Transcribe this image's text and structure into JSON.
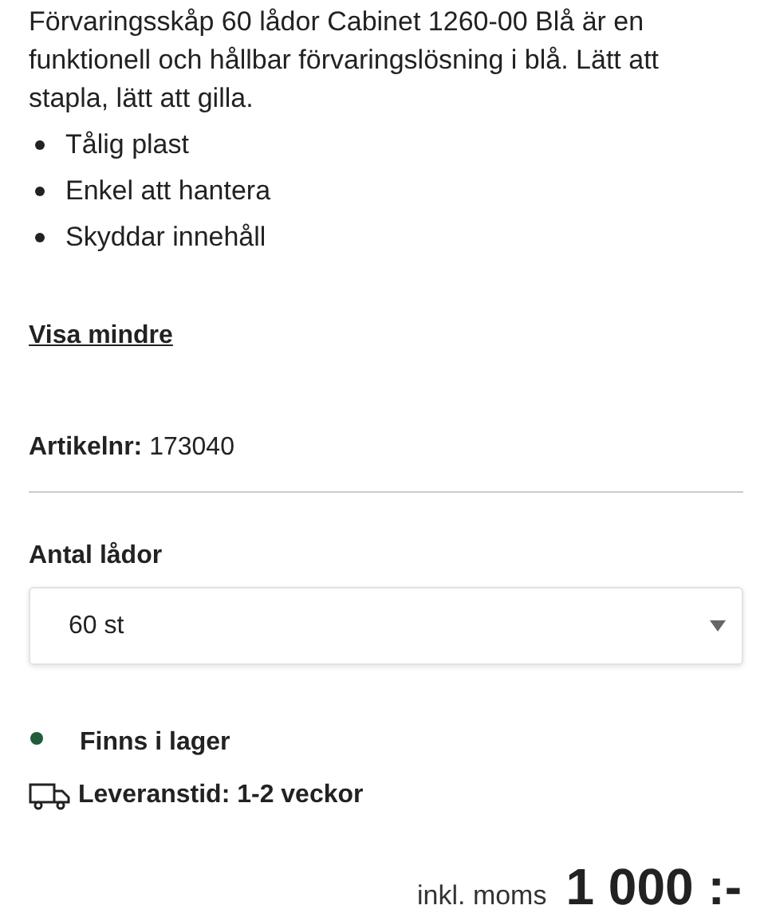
{
  "description": "Förvaringsskåp 60 lådor Cabinet 1260-00 Blå är en funktionell och hållbar förvaringslösning i blå. Lätt att stapla, lätt att gilla.",
  "features": [
    "Tålig plast",
    "Enkel att hantera",
    "Skyddar innehåll"
  ],
  "toggle_link": "Visa mindre",
  "article": {
    "label": "Artikelnr:",
    "value": "173040"
  },
  "option": {
    "label": "Antal lådor",
    "value": "60 st"
  },
  "stock": {
    "text": "Finns i lager",
    "in_stock": true
  },
  "delivery": "Leveranstid: 1-2 veckor",
  "price": {
    "tax_note": "inkl. moms",
    "amount": "1 000 :-"
  }
}
